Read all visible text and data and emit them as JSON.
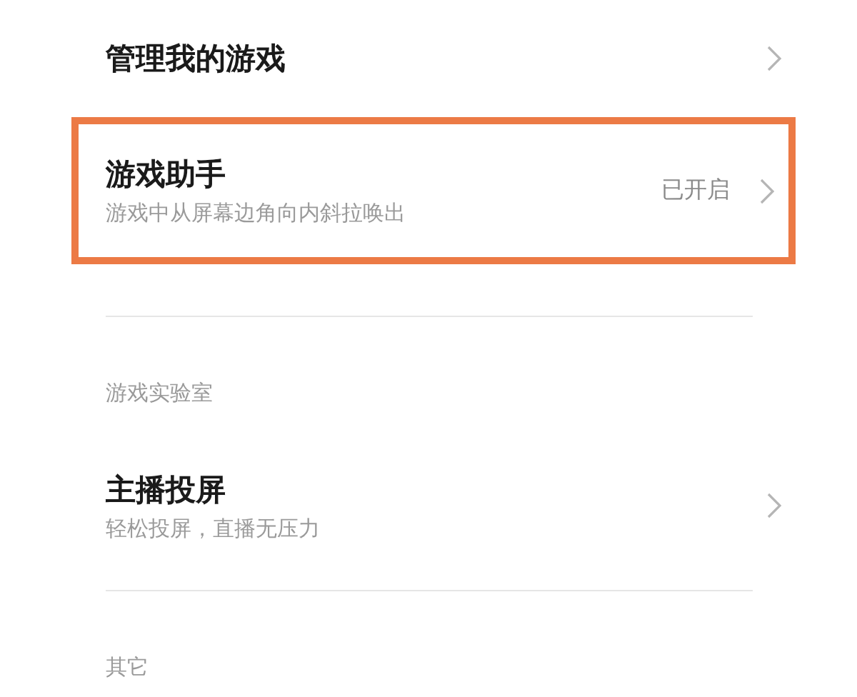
{
  "rows": [
    {
      "kind": "item",
      "title": "管理我的游戏",
      "highlighted": false
    },
    {
      "kind": "item",
      "title": "游戏助手",
      "subtitle": "游戏中从屏幕边角向内斜拉唤出",
      "value": "已开启",
      "highlighted": true
    },
    {
      "kind": "divider"
    },
    {
      "kind": "header",
      "title": "游戏实验室"
    },
    {
      "kind": "item",
      "title": "主播投屏",
      "subtitle": "轻松投屏，直播无压力",
      "highlighted": false
    },
    {
      "kind": "divider"
    },
    {
      "kind": "header",
      "title": "其它"
    }
  ]
}
